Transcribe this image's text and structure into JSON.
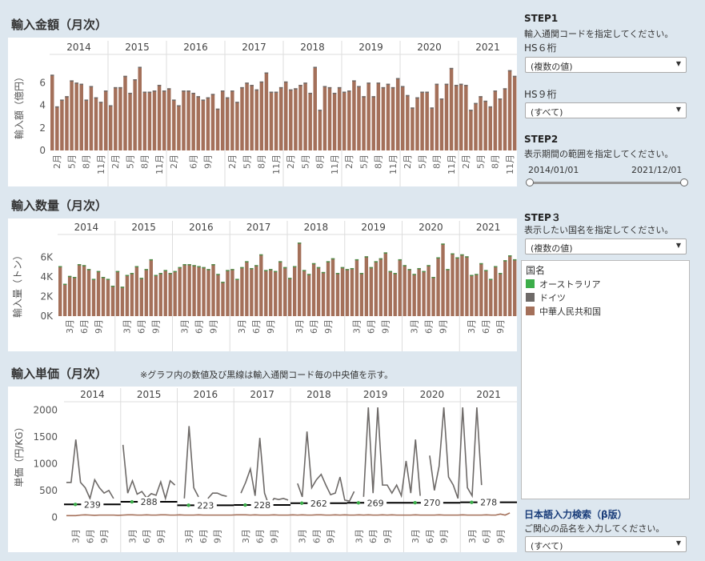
{
  "years": [
    "2014",
    "2015",
    "2016",
    "2017",
    "2018",
    "2019",
    "2020",
    "2021"
  ],
  "colors": {
    "china": "#a4705a",
    "germany": "#6e6a68",
    "australia": "#3cae4a",
    "median": "#000000"
  },
  "section1": {
    "title": "輸入金額（月次）",
    "ylabel": "輸入額（億円）",
    "yticks": [
      "0",
      "2",
      "4",
      "6"
    ],
    "xticks": [
      "2月",
      "5月",
      "8月",
      "11月",
      "2月",
      "5月",
      "8月",
      "11月",
      "2月",
      "6月",
      "9月",
      "2月",
      "5月",
      "8月",
      "11月",
      "2月",
      "5月",
      "8月",
      "11月",
      "2月",
      "5月",
      "8月",
      "11月",
      "2月",
      "5月",
      "8月",
      "11月",
      "2月",
      "5月",
      "8月",
      "11月"
    ]
  },
  "section2": {
    "title": "輸入数量（月次）",
    "ylabel": "輸入量（トン）",
    "yticks": [
      "0K",
      "2K",
      "4K",
      "6K"
    ],
    "xticks": [
      "3月",
      "6月",
      "9月"
    ]
  },
  "section3": {
    "title": "輸入単価（月次）",
    "note": "※グラフ内の数値及び黒線は輸入通関コード毎の中央値を示す。",
    "ylabel": "単価（円/KG）",
    "yticks": [
      "0",
      "500",
      "1000",
      "1500",
      "2000"
    ],
    "xticks": [
      "3月",
      "6月",
      "9月"
    ],
    "medians": [
      "239",
      "288",
      "223",
      "228",
      "262",
      "269",
      "270",
      "278"
    ]
  },
  "chart_data": [
    {
      "type": "bar",
      "title": "輸入金額（月次）",
      "ylabel": "輸入額（億円）",
      "ylim": [
        0,
        8
      ],
      "series": [
        {
          "name": "中華人民共和国",
          "values": [
            6.7,
            3.9,
            4.5,
            4.8,
            6.2,
            6.0,
            5.9,
            4.5,
            5.7,
            4.7,
            4.3,
            5.3,
            4.0,
            5.6,
            5.6,
            6.6,
            5.1,
            6.3,
            7.4,
            5.2,
            5.2,
            5.3,
            5.8,
            5.3,
            5.5,
            4.5,
            4.0,
            5.3,
            5.3,
            5.1,
            4.8,
            4.5,
            4.7,
            5.0,
            3.7,
            5.3,
            4.7,
            5.3,
            4.3,
            5.6,
            6.0,
            5.8,
            5.4,
            6.1,
            6.9,
            5.2,
            5.2,
            5.6,
            6.1,
            5.4,
            5.5,
            5.8,
            6.0,
            5.1,
            7.4,
            3.6,
            5.7,
            5.6,
            5.1,
            5.6,
            5.2,
            5.3,
            6.2,
            5.7,
            4.8,
            6.0,
            4.8,
            6.0,
            5.6,
            5.9,
            5.6,
            6.4,
            5.7,
            4.9,
            3.8,
            4.7,
            5.2,
            5.2,
            3.8,
            5.9,
            4.6,
            5.9,
            7.3,
            5.8,
            5.9,
            5.8,
            3.6,
            4.2,
            4.8,
            4.4,
            3.9,
            5.3,
            4.6,
            5.5,
            7.1,
            6.6
          ]
        }
      ]
    },
    {
      "type": "bar",
      "title": "輸入数量（月次）",
      "ylabel": "輸入量（トン）",
      "ylim": [
        0,
        8000
      ],
      "series": [
        {
          "name": "中華人民共和国",
          "values": [
            5100,
            3300,
            4100,
            4000,
            5300,
            5200,
            4800,
            3800,
            4600,
            4000,
            3800,
            3100,
            4600,
            3000,
            4200,
            4400,
            5100,
            3900,
            4800,
            5800,
            4200,
            4400,
            4700,
            4400,
            4600,
            5000,
            5300,
            5300,
            5200,
            5100,
            5000,
            4800,
            5300,
            4300,
            3500,
            4700,
            4800,
            3800,
            5000,
            5600,
            4900,
            5200,
            6300,
            4700,
            4800,
            4600,
            5600,
            5000,
            3900,
            5100,
            7500,
            4700,
            4300,
            5400,
            5000,
            4500,
            5600,
            5900,
            4400,
            5000,
            4800,
            4900,
            5800,
            4400,
            6100,
            5000,
            5600,
            5900,
            6500,
            4600,
            4400,
            5800,
            5200,
            4800,
            4300,
            4900,
            4600,
            5200,
            4000,
            6000,
            7400,
            4800,
            6400,
            6000,
            6300,
            6100,
            4200,
            4300,
            5400,
            4700,
            3800,
            5100,
            4400,
            5700,
            6200,
            5800
          ]
        }
      ]
    },
    {
      "type": "line",
      "title": "輸入単価（月次）",
      "ylabel": "単価（円/KG）",
      "ylim": [
        -100,
        2050
      ],
      "medians": [
        239,
        288,
        223,
        228,
        262,
        269,
        270,
        278
      ],
      "series": [
        {
          "name": "ドイツ",
          "values": [
            650,
            650,
            1450,
            650,
            550,
            350,
            700,
            550,
            450,
            500,
            350,
            null,
            1350,
            450,
            680,
            430,
            480,
            360,
            440,
            410,
            660,
            350,
            680,
            600,
            null,
            350,
            1700,
            550,
            380,
            null,
            350,
            450,
            450,
            410,
            390,
            null,
            null,
            450,
            650,
            900,
            400,
            1480,
            450,
            200,
            350,
            330,
            350,
            320,
            null,
            630,
            380,
            1600,
            550,
            700,
            800,
            600,
            420,
            450,
            750,
            320,
            300,
            480,
            null,
            380,
            2050,
            450,
            2050,
            600,
            600,
            450,
            600,
            400,
            1050,
            450,
            1450,
            400,
            null,
            1150,
            500,
            950,
            2050,
            750,
            600,
            350,
            2050,
            550,
            400,
            2050,
            600,
            null,
            null,
            null,
            null,
            null,
            null,
            null
          ]
        },
        {
          "name": "中華人民共和国",
          "values": [
            30,
            30,
            30,
            40,
            45,
            40,
            35,
            40,
            40,
            40,
            40,
            35,
            40,
            45,
            45,
            40,
            40,
            45,
            40,
            40,
            45,
            45,
            40,
            40,
            45,
            40,
            40,
            40,
            45,
            40,
            40,
            40,
            40,
            40,
            40,
            40,
            45,
            45,
            45,
            40,
            45,
            40,
            40,
            40,
            45,
            40,
            40,
            40,
            45,
            40,
            45,
            40,
            40,
            45,
            45,
            40,
            40,
            45,
            40,
            45,
            40,
            40,
            45,
            40,
            45,
            40,
            40,
            45,
            40,
            45,
            40,
            40,
            40,
            40,
            45,
            40,
            40,
            40,
            40,
            45,
            40,
            40,
            40,
            40,
            45,
            40,
            40,
            40,
            40,
            45,
            40,
            40,
            60,
            40,
            80,
            null
          ]
        }
      ]
    }
  ],
  "sidebar": {
    "step1": "STEP1",
    "step1_desc": "輸入通関コードを指定してください。",
    "hs6_label": "HS６桁",
    "hs6_value": "(複数の値)",
    "hs9_label": "HS９桁",
    "hs9_value": "(すべて)",
    "step2": "STEP2",
    "step2_desc": "表示期間の範囲を指定してください。",
    "date_from": "2014/01/01",
    "date_to": "2021/12/01",
    "step3": "STEP３",
    "step3_desc": "表示したい国名を指定してください。",
    "country_value": "(複数の値)",
    "legend_title": "国名",
    "legend": [
      {
        "label": "オーストラリア",
        "color": "#3cae4a"
      },
      {
        "label": "ドイツ",
        "color": "#6e6a68"
      },
      {
        "label": "中華人民共和国",
        "color": "#a4705a"
      }
    ],
    "search_title": "日本語入力検索（β版）",
    "search_desc": "ご関心の品名を入力してください。",
    "search_value": "(すべて)"
  }
}
